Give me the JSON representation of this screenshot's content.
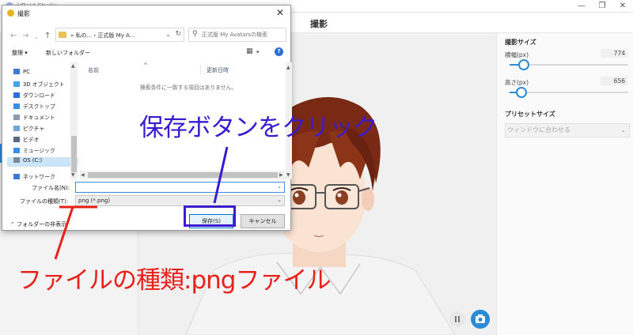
{
  "app": {
    "window_title": "VRoid Studio",
    "page_title": "撮影"
  },
  "window_controls": {
    "minimize": "—",
    "maximize": "❐",
    "close": "✕"
  },
  "right_panel": {
    "capture_size_heading": "撮影サイズ",
    "width_label": "横幅(px)",
    "width_value": "774",
    "width_fraction": 0.12,
    "height_label": "高さ(px)",
    "height_value": "656",
    "height_fraction": 0.1,
    "preset_heading": "プリセットサイズ",
    "preset_value": "ウィンドウに合わせる"
  },
  "dialog": {
    "title": "撮影",
    "address_path": "«  私の...  ›  正式版 My A...",
    "search_placeholder": "正式版 My Avatarsの検索",
    "toolbar_organize": "整理 ▾",
    "toolbar_new_folder": "新しいフォルダー",
    "nav_items": [
      {
        "label": "PC",
        "icon": "pc-icon",
        "color": "#3a7bd5"
      },
      {
        "label": "3D オブジェクト",
        "icon": "cube-icon",
        "color": "#4aa0e6"
      },
      {
        "label": "ダウンロード",
        "icon": "download-icon",
        "color": "#2a6fd6"
      },
      {
        "label": "デスクトップ",
        "icon": "desktop-icon",
        "color": "#3a8ee6"
      },
      {
        "label": "ドキュメント",
        "icon": "document-icon",
        "color": "#8a9bb0"
      },
      {
        "label": "ピクチャ",
        "icon": "pictures-icon",
        "color": "#6aa8d8"
      },
      {
        "label": "ビデオ",
        "icon": "video-icon",
        "color": "#5a6a80"
      },
      {
        "label": "ミュージック",
        "icon": "music-icon",
        "color": "#3a8ee6"
      },
      {
        "label": "OS (C:)",
        "icon": "drive-icon",
        "color": "#7a8a9a"
      },
      {
        "label": "ネットワーク",
        "icon": "network-icon",
        "color": "#3a7bd5"
      }
    ],
    "column_name": "名前",
    "column_date": "更新日時",
    "empty_message": "検索条件に一致する項目はありません。",
    "filename_label": "ファイル名(N):",
    "filename_value": "",
    "filetype_label": "ファイルの種類(T):",
    "filetype_value": "png (*.png)",
    "hide_folders": "フォルダーの非表示",
    "save_button": "保存(S)",
    "cancel_button": "キャンセル"
  },
  "annotations": {
    "save_callout": "保存ボタンをクリック",
    "filetype_callout": "ファイルの種類:pngファイル",
    "blue": "#3b1bcf",
    "red": "#e8201a"
  },
  "colors": {
    "accent": "#2a8bd6"
  }
}
